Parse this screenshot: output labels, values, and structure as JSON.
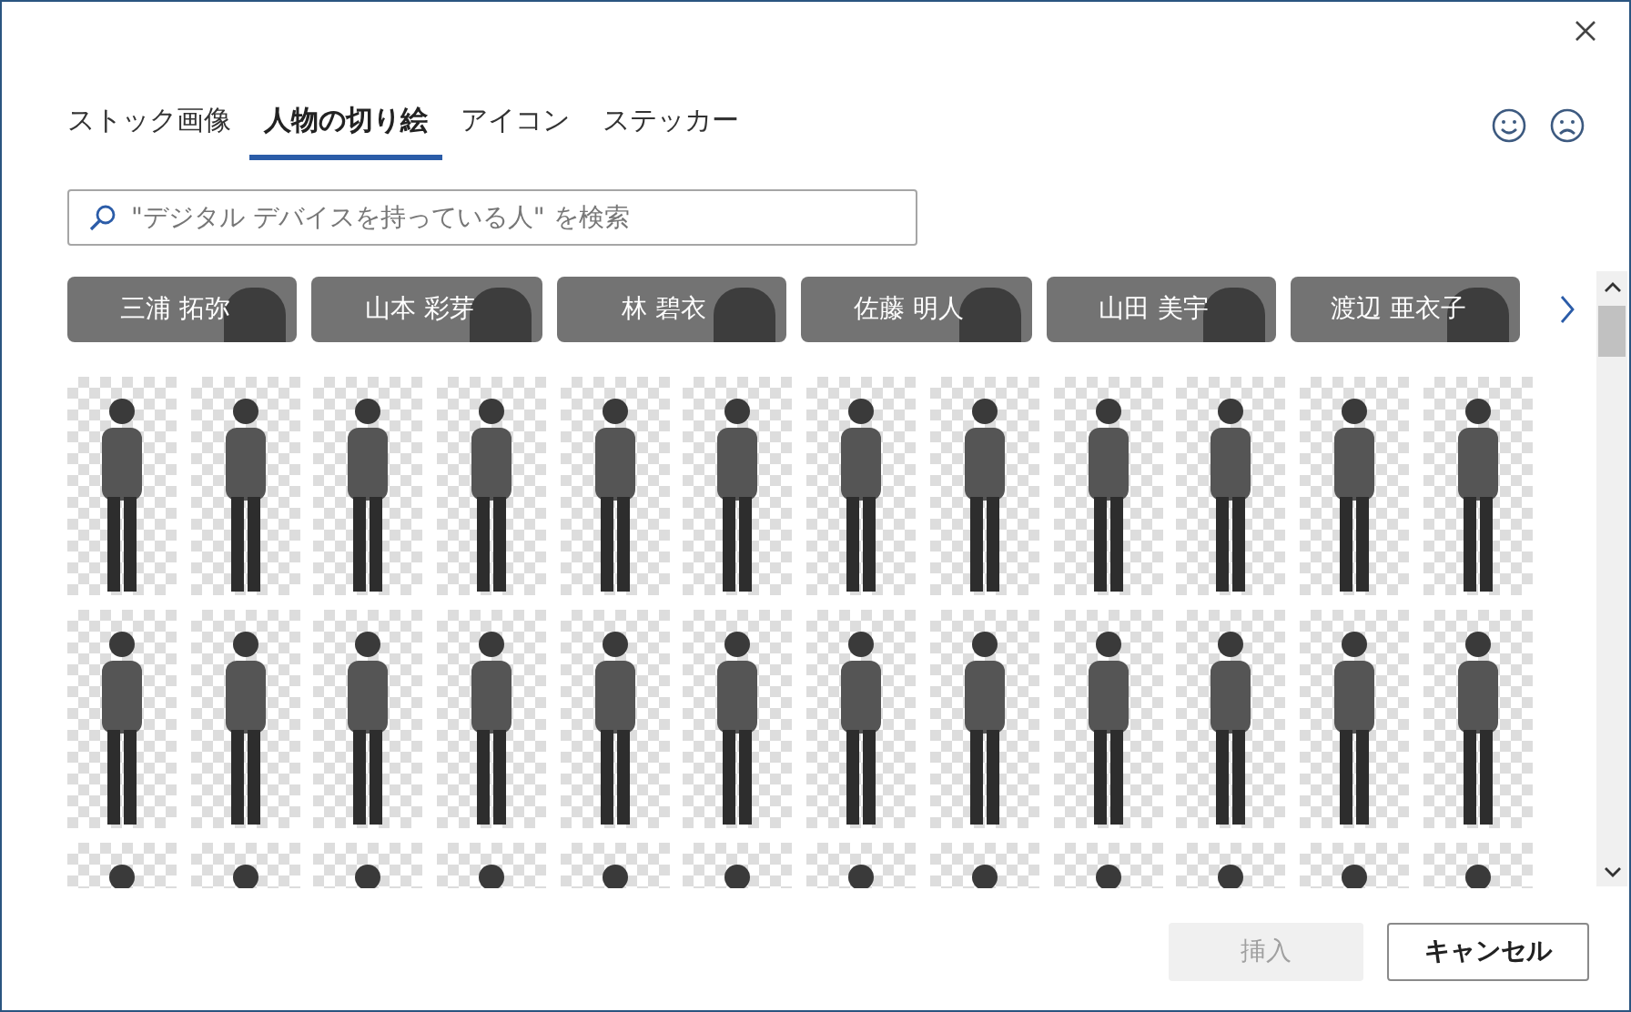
{
  "tabs": [
    {
      "label": "ストック画像",
      "selected": false
    },
    {
      "label": "人物の切り絵",
      "selected": true
    },
    {
      "label": "アイコン",
      "selected": false
    },
    {
      "label": "ステッカー",
      "selected": false
    }
  ],
  "search": {
    "placeholder": "\"デジタル デバイスを持っている人\" を検索"
  },
  "people": [
    {
      "name": "三浦 拓弥"
    },
    {
      "name": "山本 彩芽"
    },
    {
      "name": "林 碧衣"
    },
    {
      "name": "佐藤 明人"
    },
    {
      "name": "山田 美宇"
    },
    {
      "name": "渡辺 亜衣子"
    }
  ],
  "buttons": [
    {
      "label": "挿入",
      "disabled": true
    },
    {
      "label": "キャンセル",
      "disabled": false
    }
  ]
}
